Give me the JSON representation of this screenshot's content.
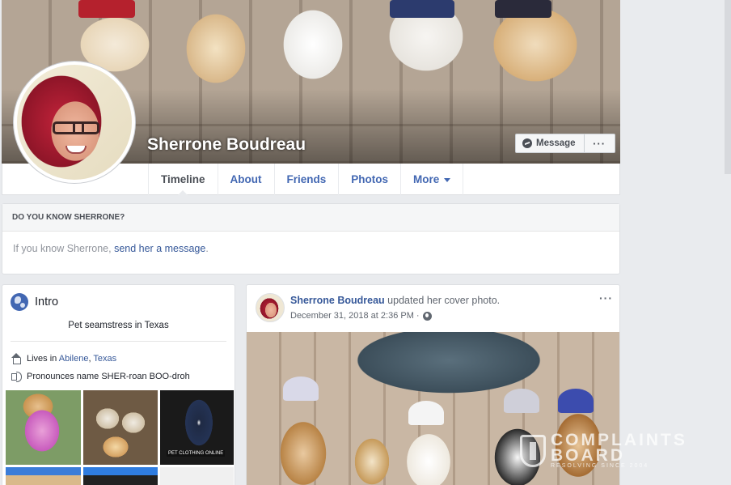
{
  "profile": {
    "name": "Sherrone Boudreau",
    "message_label": "Message",
    "more_label": "···"
  },
  "tabs": [
    {
      "label": "Timeline"
    },
    {
      "label": "About"
    },
    {
      "label": "Friends"
    },
    {
      "label": "Photos"
    },
    {
      "label": "More"
    }
  ],
  "know": {
    "heading": "DO YOU KNOW SHERRONE?",
    "text_prefix": "If you know Sherrone, ",
    "link": "send her a message",
    "text_suffix": "."
  },
  "intro": {
    "title": "Intro",
    "bio": "Pet seamstress in Texas",
    "lives_prefix": "Lives in ",
    "city": "Abilene",
    "separator": ", ",
    "state": "Texas",
    "pronounce": "Pronounces name SHER-roan BOO-droh",
    "photo_tag": "PET CLOTHING ONLINE"
  },
  "post": {
    "author": "Sherrone Boudreau",
    "action": " updated her cover photo.",
    "timestamp": "December 31, 2018 at 2:36 PM ·",
    "more": "···"
  },
  "watermark": {
    "line1": "COMPLAINTS",
    "line2": "BOARD",
    "sub": "RESOLVING SINCE 2004"
  },
  "colors": {
    "link": "#365899",
    "tab_link": "#4267b2",
    "page_bg": "#e9ebee"
  }
}
